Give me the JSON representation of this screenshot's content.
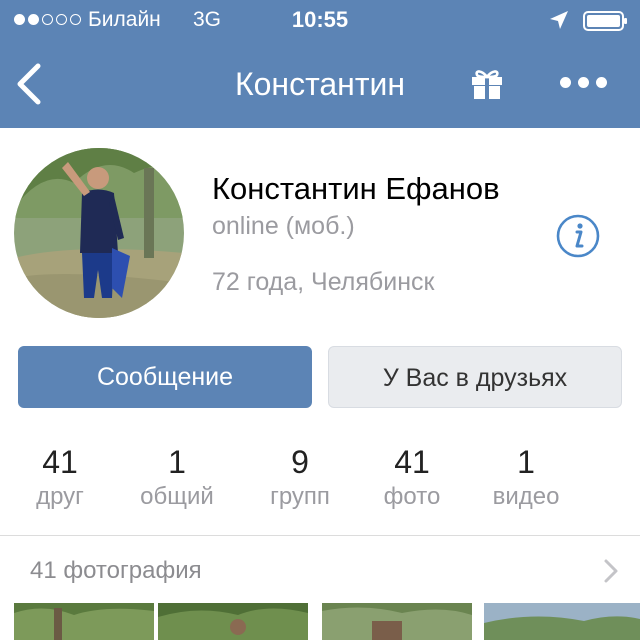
{
  "status_bar": {
    "carrier": "Билайн",
    "network": "3G",
    "time": "10:55",
    "signal_dots_filled": 2,
    "signal_dots_total": 5,
    "icons": [
      "location-arrow-icon",
      "battery-icon"
    ]
  },
  "nav": {
    "title": "Константин",
    "icons": [
      "back-chevron-icon",
      "gift-icon",
      "more-icon"
    ]
  },
  "profile": {
    "name": "Константин Ефанов",
    "status": "online (моб.)",
    "info": "72 года, Челябинск",
    "info_icon": "info-icon"
  },
  "buttons": {
    "message": "Сообщение",
    "friends": "У Вас в друзьях"
  },
  "stats": [
    {
      "num": "41",
      "label": "друг"
    },
    {
      "num": "1",
      "label": "общий"
    },
    {
      "num": "9",
      "label": "групп"
    },
    {
      "num": "41",
      "label": "фото"
    },
    {
      "num": "1",
      "label": "видео"
    }
  ],
  "photos": {
    "title": "41 фотография"
  },
  "colors": {
    "brand": "#5c84b5",
    "secondary_text": "#9b9ba0",
    "info_icon": "#4a87c8"
  }
}
